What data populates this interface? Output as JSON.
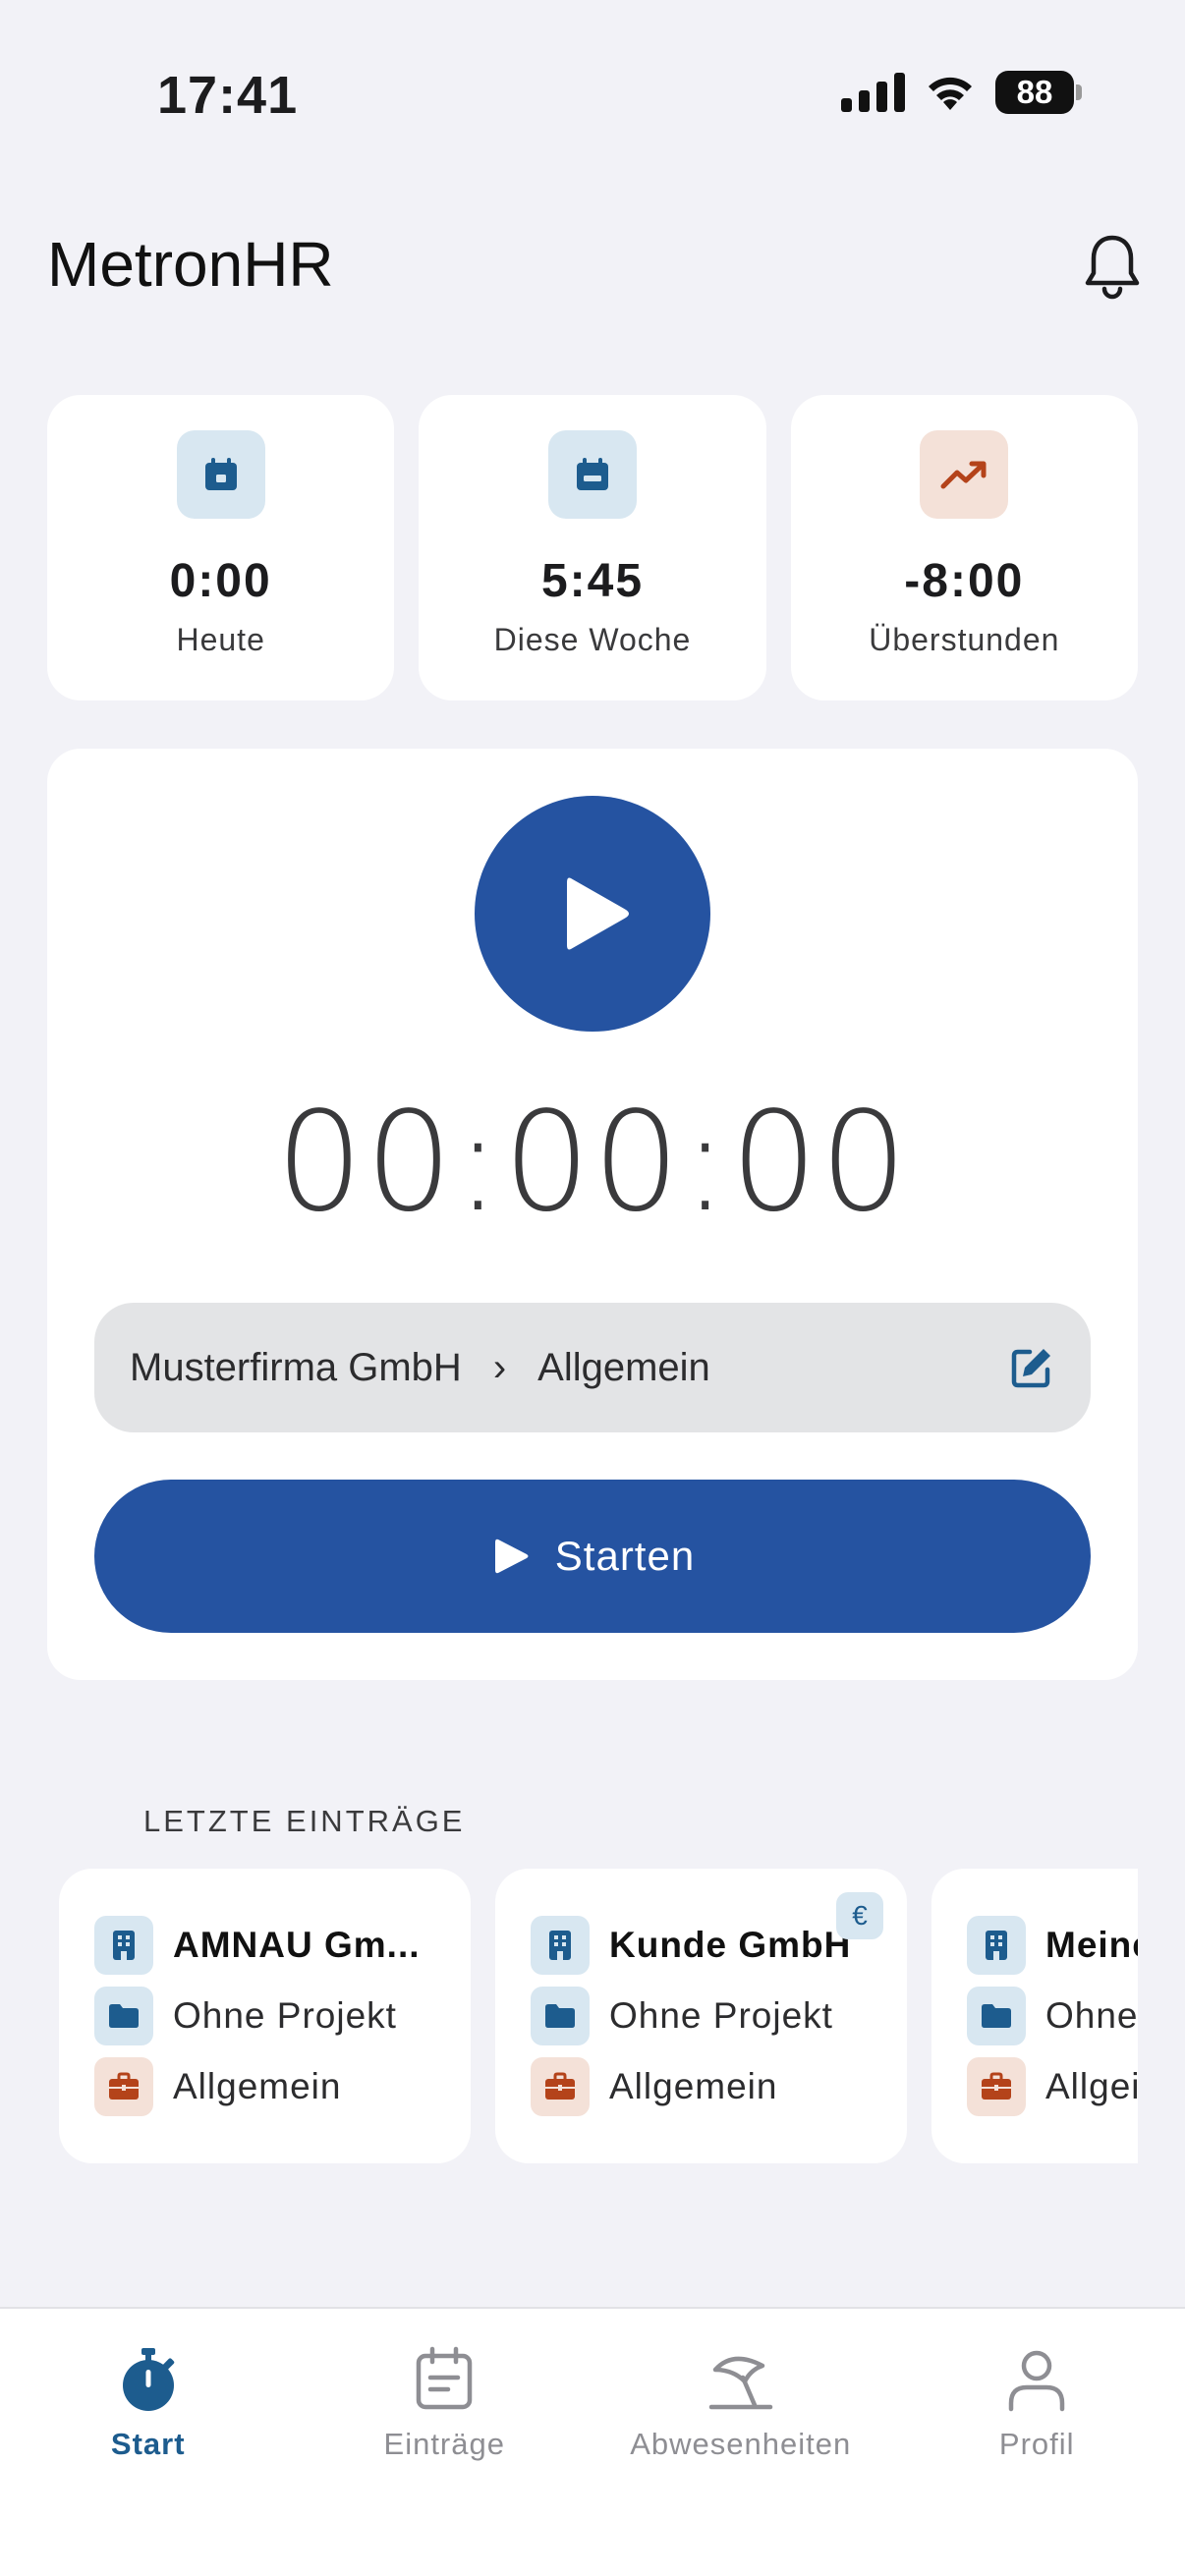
{
  "status_bar": {
    "time": "17:41",
    "battery": "88"
  },
  "header": {
    "title": "MetronHR",
    "icon": "bell-icon"
  },
  "stats": [
    {
      "value": "0:00",
      "label": "Heute",
      "icon": "calendar-icon",
      "accent": "#1d5c8e"
    },
    {
      "value": "5:45",
      "label": "Diese Woche",
      "icon": "calendar-week-icon",
      "accent": "#1d5c8e"
    },
    {
      "value": "-8:00",
      "label": "Überstunden",
      "icon": "trending-up-icon",
      "accent": "#b4431a"
    }
  ],
  "timer": {
    "display": "00:00:00",
    "context": {
      "company": "Musterfirma GmbH",
      "separator": "›",
      "activity": "Allgemein"
    },
    "start_label": "Starten"
  },
  "recent": {
    "title": "LETZTE EINTRÄGE",
    "entries": [
      {
        "company": "AMNAU Gm...",
        "project": "Ohne Projekt",
        "activity": "Allgemein",
        "billable": false
      },
      {
        "company": "Kunde GmbH",
        "project": "Ohne Projekt",
        "activity": "Allgemein",
        "billable": true,
        "badge": "€"
      },
      {
        "company": "Meine",
        "project": "Ohne",
        "activity": "Allgei",
        "billable": false
      }
    ]
  },
  "tabs": [
    {
      "label": "Start",
      "icon": "stopwatch-icon",
      "active": true
    },
    {
      "label": "Einträge",
      "icon": "calendar-list-icon",
      "active": false
    },
    {
      "label": "Abwesenheiten",
      "icon": "beach-umbrella-icon",
      "active": false
    },
    {
      "label": "Profil",
      "icon": "person-icon",
      "active": false
    }
  ],
  "colors": {
    "primary": "#2553a1",
    "accent_blue": "#1d5c8e",
    "accent_orange": "#b4431a",
    "background": "#f2f2f7"
  }
}
